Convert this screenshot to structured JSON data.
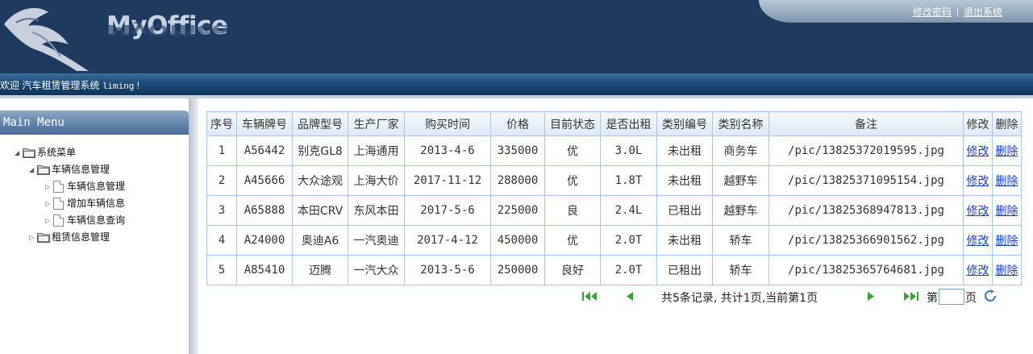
{
  "app": {
    "logo": "MyOffice",
    "links": {
      "change_password": "修改密码",
      "separator": "|",
      "logout": "退出系统"
    },
    "welcome_prefix": "欢迎 汽车租赁管理系统",
    "username": "liming",
    "welcome_suffix": "!"
  },
  "sidebar": {
    "title": "Main Menu",
    "tree": {
      "root": "系统菜单",
      "vehicle_mgmt": "车辆信息管理",
      "vehicle_children": [
        "车辆信息管理",
        "增加车辆信息",
        "车辆信息查询"
      ],
      "rental_mgmt": "租赁信息管理"
    }
  },
  "table": {
    "headers": [
      "序号",
      "车辆牌号",
      "品牌型号",
      "生产厂家",
      "购买时间",
      "价格",
      "目前状态",
      "是否出租",
      "类别编号",
      "类别名称",
      "备注",
      "修改",
      "删除"
    ],
    "rows": [
      [
        "1",
        "A56442",
        "别克GL8",
        "上海通用",
        "2013-4-6",
        "335000",
        "优",
        "3.0L",
        "未出租",
        "商务车",
        "/pic/13825372019595.jpg",
        "修改",
        "删除"
      ],
      [
        "2",
        "A45666",
        "大众途观",
        "上海大价",
        "2017-11-12",
        "288000",
        "优",
        "1.8T",
        "未出租",
        "越野车",
        "/pic/13825371095154.jpg",
        "修改",
        "删除"
      ],
      [
        "3",
        "A65888",
        "本田CRV",
        "东风本田",
        "2017-5-6",
        "225000",
        "良",
        "2.4L",
        "已租出",
        "越野车",
        "/pic/13825368947813.jpg",
        "修改",
        "删除"
      ],
      [
        "4",
        "A24000",
        "奥迪A6",
        "一汽奥迪",
        "2017-4-12",
        "450000",
        "优",
        "2.0T",
        "未出租",
        "轿车",
        "/pic/13825366901562.jpg",
        "修改",
        "删除"
      ],
      [
        "5",
        "A85410",
        "迈腾",
        "一汽大众",
        "2013-5-6",
        "250000",
        "良好",
        "2.0T",
        "已租出",
        "轿车",
        "/pic/13825365764681.jpg",
        "修改",
        "删除"
      ]
    ]
  },
  "pager": {
    "info": "共5条记录, 共计1页,当前第1页",
    "goto_prefix": "第",
    "goto_value": "",
    "goto_suffix": "页"
  },
  "colors": {
    "header_bg": "#1f3a5f",
    "table_border": "#a9c6e6",
    "link": "#1a3fb5",
    "pager_icon": "#3aa03a"
  }
}
